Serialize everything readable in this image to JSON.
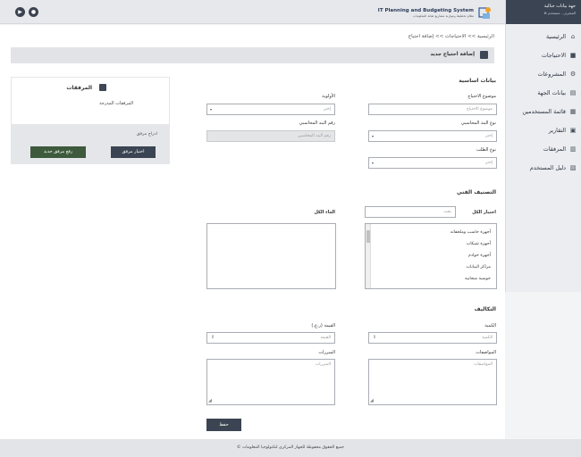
{
  "topbar": {
    "left_btn1_glyph": "▶",
    "left_btn2_glyph": "●",
    "logo_title": "IT Planning and Budgeting System",
    "logo_subtitle": "نظام تخطيط وموازنة مشاريع تقانة المعلومات"
  },
  "sidebar": {
    "user_name": "جهة بيانات جنالية",
    "user_role": "المشرف - مستخدم ⊕",
    "items": [
      {
        "label": "الرئيسية",
        "icon": "home-icon",
        "glyph": "⌂"
      },
      {
        "label": "الاحتياجات",
        "icon": "cube-icon",
        "glyph": "■"
      },
      {
        "label": "المشروعات",
        "icon": "projects-icon",
        "glyph": "⚙"
      },
      {
        "label": "بيانات الجهة",
        "icon": "building-icon",
        "glyph": "▤"
      },
      {
        "label": "قائمة المستخدمين",
        "icon": "users-icon",
        "glyph": "▦"
      },
      {
        "label": "التقارير",
        "icon": "reports-icon",
        "glyph": "▣"
      },
      {
        "label": "المرفقات",
        "icon": "attachments-icon",
        "glyph": "▥"
      },
      {
        "label": "دليل المستخدم",
        "icon": "guide-icon",
        "glyph": "▧"
      }
    ]
  },
  "breadcrumb": {
    "home": "الرئيسية",
    "sep": ">>",
    "needs": "الاحتياجات",
    "current": "إضافة احتياج"
  },
  "page_title": "إضافة احتياج جديد",
  "attachments": {
    "title": "المرفقات",
    "subtitle": "المرفقات المدرجة",
    "add_label": "ادراج مرفق",
    "choose_btn": "اختيار مرفق",
    "upload_btn": "رفع مرفق جديد"
  },
  "form": {
    "basic_section": "بيانات اساسية",
    "need_subject_label": "موضوع الاحتياج",
    "need_subject_placeholder": "موضوع الاحتياج",
    "priority_label": "الأولوية",
    "priority_value": "إختر",
    "account_type_label": "نوع البند المحاسبي",
    "account_type_value": "إختر",
    "account_number_label": "رقم البند المحاسبي",
    "account_number_placeholder": "رقم البند المحاسبي",
    "request_type_label": "نوع الطلب",
    "request_type_value": "إختر",
    "classification_section": "التصنيف الفني",
    "select_all": "اختيار الكل",
    "search_placeholder": "بحث",
    "deselect_all": "الغاء الكل",
    "options": [
      "أجهزة حاسب وملحقاته",
      "أجهزة شبكات",
      "أجهزة خوادم",
      "مراكز البيانات",
      "حوسبة سحابية"
    ],
    "costs_section": "التكاليف",
    "quantity_label": "الكمية",
    "quantity_placeholder": "الكمية",
    "value_label": "القيمة (ر.ع.)",
    "value_placeholder": "القيمة",
    "specs_label": "المواصفات",
    "specs_placeholder": "المواصفات",
    "justification_label": "المبررات",
    "justification_placeholder": "المبررات",
    "save_btn": "حفظ"
  },
  "footer": "جميع الحقوق محفوظة للجهاز المركزي لتكنولوجيا المعلومات ©",
  "colors": {
    "dark": "#3b4452",
    "green": "#3d5a3c",
    "sidebar_bg": "#ebedf0",
    "header_bg": "#e1e3e6"
  }
}
